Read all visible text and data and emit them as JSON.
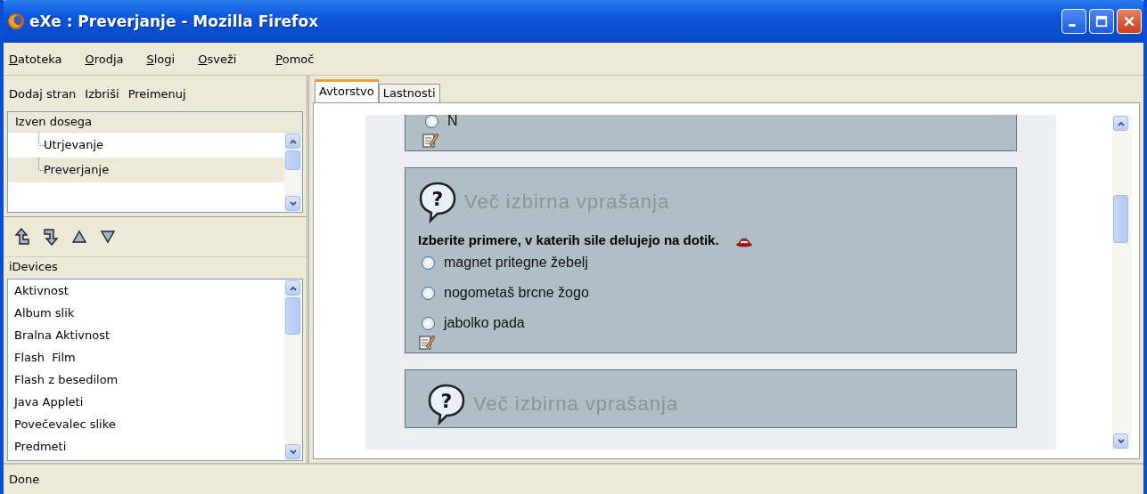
{
  "window": {
    "title": "eXe : Preverjanje - Mozilla Firefox"
  },
  "menu": [
    "Datoteka",
    "Orodja",
    "Slogi",
    "Osveži",
    "Pomoč"
  ],
  "page_toolbar": [
    "Dodaj stran",
    "Izbriši",
    "Preimenuj"
  ],
  "outline": {
    "root": "Izven dosega",
    "children": [
      {
        "label": "Utrjevanje",
        "selected": false
      },
      {
        "label": "Preverjanje",
        "selected": true
      }
    ]
  },
  "idevices": {
    "title": "iDevices",
    "items": [
      "Aktivnost",
      "Album slik",
      "Bralna Aktivnost",
      "Flash  Film",
      "Flash z besedilom",
      "Java Appleti",
      "Povečevalec slike",
      "Predmeti"
    ]
  },
  "tabs": [
    {
      "label": "Avtorstvo",
      "selected": true
    },
    {
      "label": "Lastnosti",
      "selected": false
    }
  ],
  "cards": [
    {
      "kind": "tail",
      "options": [
        {
          "label": "N",
          "checked": false
        }
      ]
    },
    {
      "kind": "full",
      "icon": "?",
      "title": "Več izbirna vprašanja",
      "question": "Izberite primere, v katerih sile delujejo na dotik.",
      "options": [
        {
          "label": "magnet pritegne žebelj",
          "checked": false
        },
        {
          "label": "nogometaš brcne žogo",
          "checked": false
        },
        {
          "label": "jabolko pada",
          "checked": false
        }
      ]
    },
    {
      "kind": "head",
      "icon": "?",
      "title": "Več izbirna vprašanja"
    }
  ],
  "status_bar": "Done"
}
